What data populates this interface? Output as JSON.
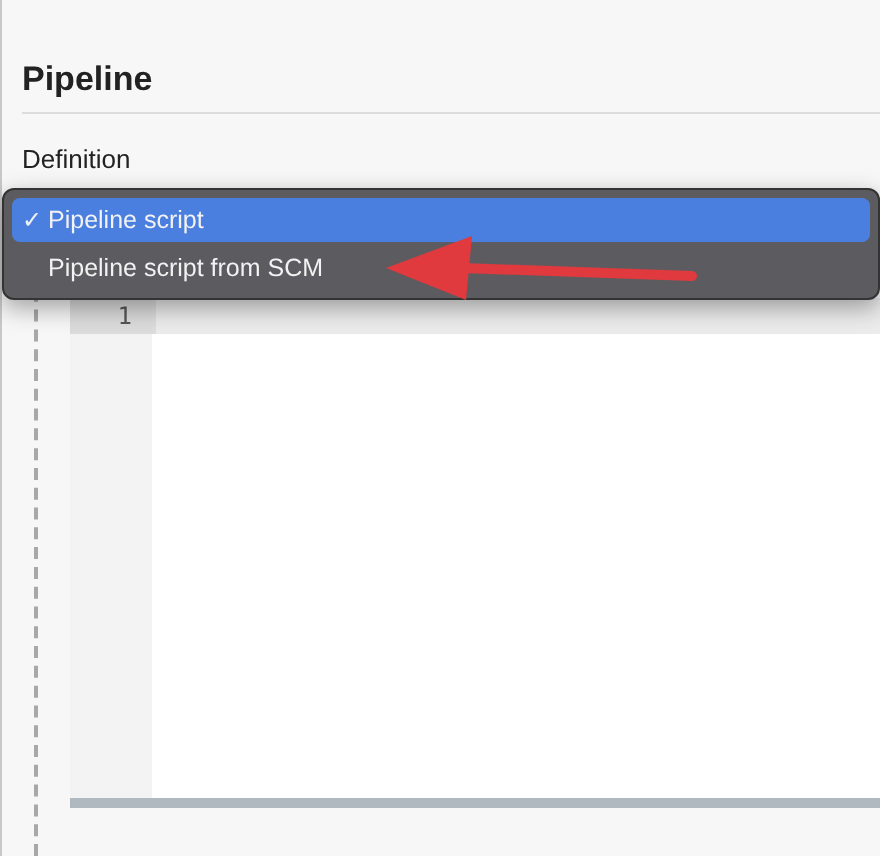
{
  "section": {
    "title": "Pipeline"
  },
  "definition": {
    "label": "Definition",
    "check_mark": "✓",
    "options": [
      {
        "label": "Pipeline script",
        "selected": true
      },
      {
        "label": "Pipeline script from SCM",
        "selected": false
      }
    ]
  },
  "editor": {
    "line_numbers": [
      "1"
    ]
  }
}
